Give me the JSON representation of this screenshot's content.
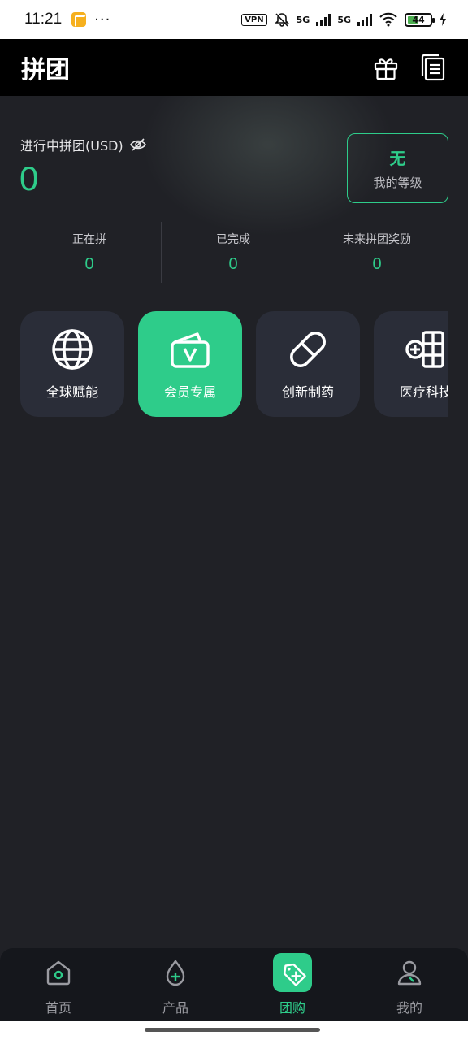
{
  "status_bar": {
    "time": "11:21",
    "dots": "···",
    "vpn": "VPN",
    "network1": "5G",
    "network2": "5G",
    "battery": "44"
  },
  "header": {
    "title": "拼团"
  },
  "summary": {
    "ongoing_label": "进行中拼团(USD)",
    "ongoing_value": "0",
    "level_value": "无",
    "level_label": "我的等级"
  },
  "stats": [
    {
      "label": "正在拼",
      "value": "0"
    },
    {
      "label": "已完成",
      "value": "0"
    },
    {
      "label": "未来拼团奖励",
      "value": "0"
    }
  ],
  "categories": [
    {
      "label": "全球赋能",
      "icon": "globe-icon",
      "active": false
    },
    {
      "label": "会员专属",
      "icon": "member-card-icon",
      "active": true
    },
    {
      "label": "创新制药",
      "icon": "pill-icon",
      "active": false
    },
    {
      "label": "医疗科技",
      "icon": "medical-tech-icon",
      "active": false
    }
  ],
  "nav": [
    {
      "label": "首页",
      "icon": "home-icon",
      "active": false
    },
    {
      "label": "产品",
      "icon": "drop-plus-icon",
      "active": false
    },
    {
      "label": "团购",
      "icon": "tag-icon",
      "active": true
    },
    {
      "label": "我的",
      "icon": "profile-icon",
      "active": false
    }
  ],
  "colors": {
    "accent": "#2ecc8a",
    "background": "#202126",
    "card": "#2a2d38",
    "header": "#000000"
  }
}
